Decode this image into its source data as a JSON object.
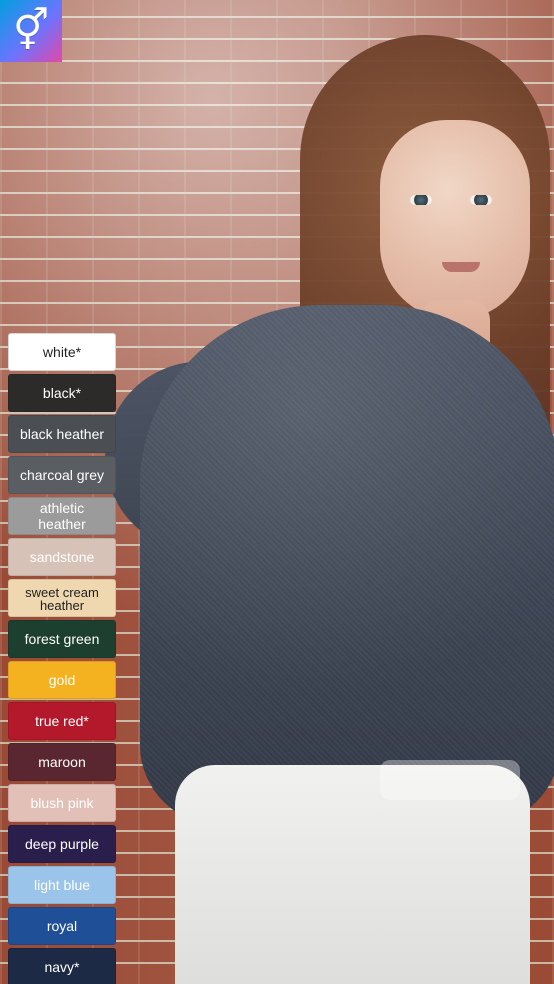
{
  "icon": {
    "name": "gender-symbol-icon",
    "glyph": "⚥",
    "gradient": [
      "#00a0df",
      "#6b74ff",
      "#e646a8"
    ]
  },
  "swatches": [
    {
      "label": "white*",
      "bg": "#ffffff",
      "fg": "#1f1f1f"
    },
    {
      "label": "black*",
      "bg": "#2d2a2a",
      "fg": "#ffffff"
    },
    {
      "label": "black heather",
      "bg": "#4b4f54",
      "fg": "#ffffff"
    },
    {
      "label": "charcoal grey",
      "bg": "#5a5d62",
      "fg": "#ffffff"
    },
    {
      "label": "athletic heather",
      "bg": "#9b9b9b",
      "fg": "#ffffff"
    },
    {
      "label": "sandstone",
      "bg": "#d6c2b7",
      "fg": "#ffffff"
    },
    {
      "label": "sweet cream heather",
      "bg": "#efd8b0",
      "fg": "#1f1f1f"
    },
    {
      "label": "forest green",
      "bg": "#1d3f2f",
      "fg": "#ffffff"
    },
    {
      "label": "gold",
      "bg": "#f4b220",
      "fg": "#ffffff"
    },
    {
      "label": "true red*",
      "bg": "#b4192b",
      "fg": "#ffffff"
    },
    {
      "label": "maroon",
      "bg": "#5a2630",
      "fg": "#ffffff"
    },
    {
      "label": "blush pink",
      "bg": "#e2c0b7",
      "fg": "#ffffff"
    },
    {
      "label": "deep purple",
      "bg": "#2a1f4c",
      "fg": "#ffffff"
    },
    {
      "label": "light blue",
      "bg": "#9bc4ea",
      "fg": "#ffffff"
    },
    {
      "label": "royal",
      "bg": "#1f4f96",
      "fg": "#ffffff"
    },
    {
      "label": "navy*",
      "bg": "#1d2a45",
      "fg": "#ffffff"
    }
  ]
}
